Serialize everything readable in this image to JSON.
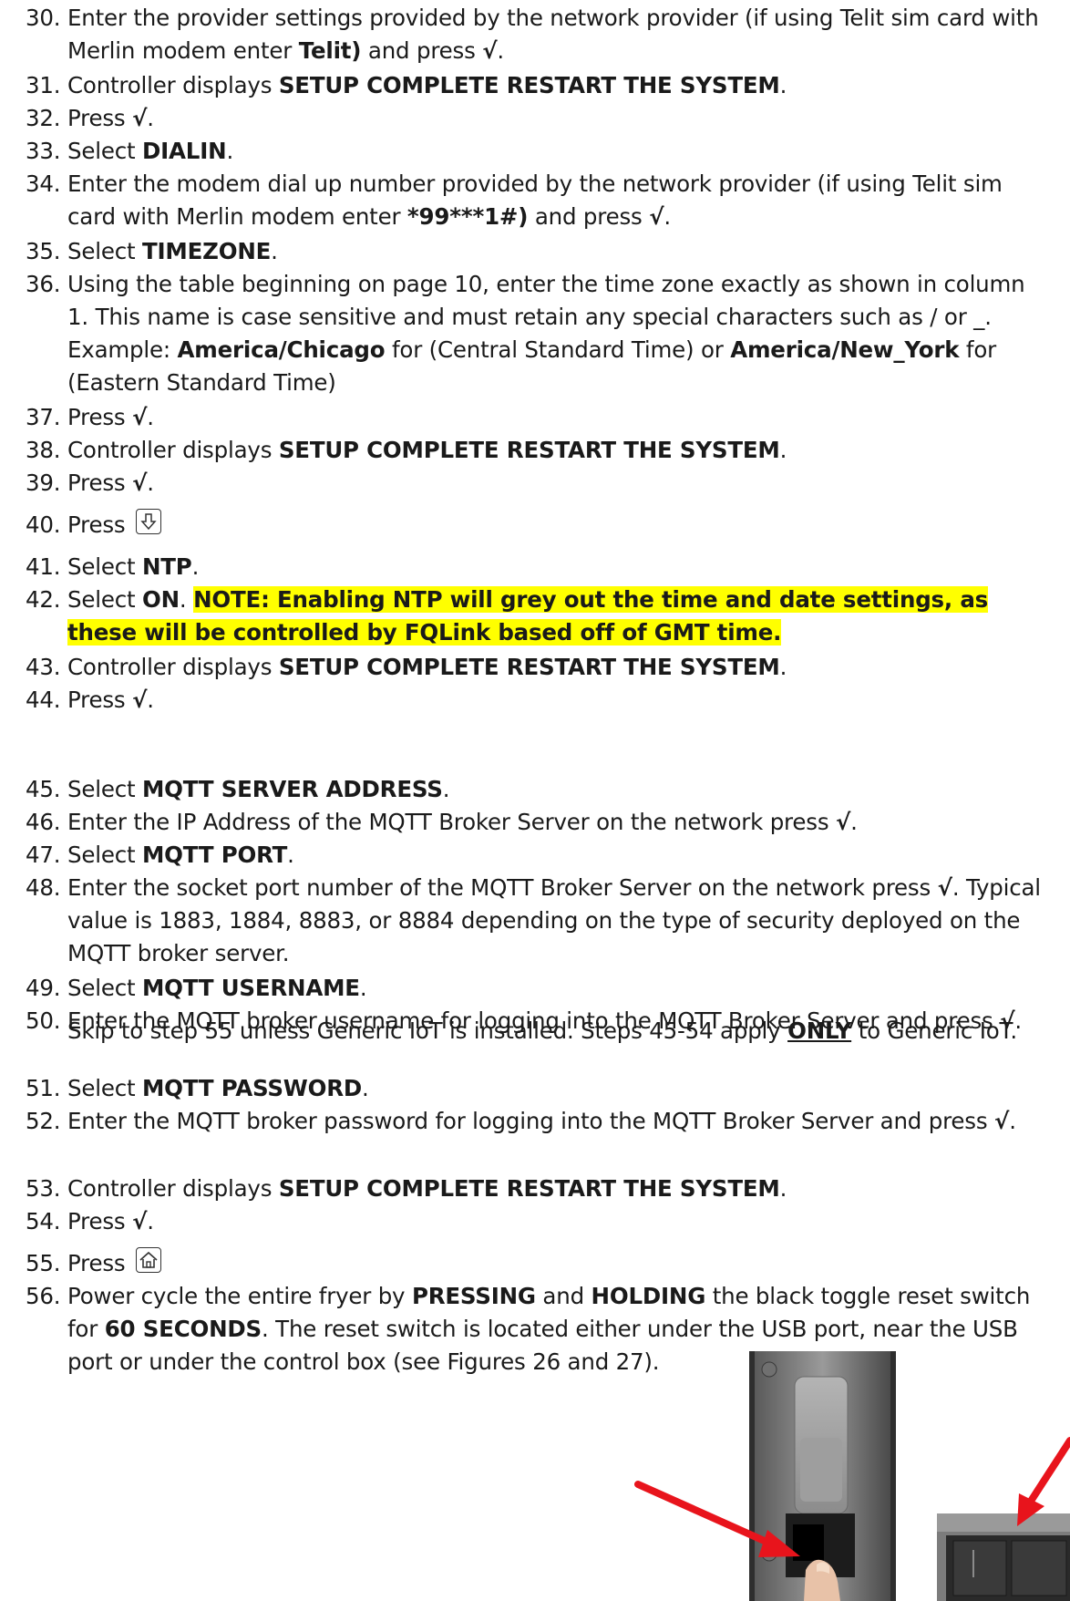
{
  "steps": [
    {
      "num": "30.",
      "parts": [
        [
          "Enter the provider settings provided by the network provider (if using Telit sim card with Merlin modem enter ",
          0
        ],
        [
          "Telit)",
          1
        ],
        [
          " and press ",
          0
        ],
        [
          "√",
          1
        ],
        [
          ".",
          0
        ]
      ]
    },
    {
      "num": "31.",
      "parts": [
        [
          "Controller displays ",
          0
        ],
        [
          "SETUP COMPLETE RESTART THE SYSTEM",
          1
        ],
        [
          ".",
          0
        ]
      ]
    },
    {
      "num": "32.",
      "parts": [
        [
          "Press ",
          0
        ],
        [
          "√",
          1
        ],
        [
          ".",
          0
        ]
      ]
    },
    {
      "num": "33.",
      "parts": [
        [
          "Select ",
          0
        ],
        [
          "DIALIN",
          1
        ],
        [
          ".",
          0
        ]
      ]
    },
    {
      "num": "34.",
      "parts": [
        [
          "Enter the modem dial up number provided by the network provider (if using Telit sim card with Merlin modem enter ",
          0
        ],
        [
          "*99***1#)",
          1
        ],
        [
          " and press ",
          0
        ],
        [
          "√",
          1
        ],
        [
          ".",
          0
        ]
      ]
    },
    {
      "num": "35.",
      "parts": [
        [
          "Select ",
          0
        ],
        [
          "TIMEZONE",
          1
        ],
        [
          ".",
          0
        ]
      ]
    },
    {
      "num": "36.",
      "parts": [
        [
          "Using the table beginning on page 10, enter the time zone exactly as shown in column 1.  This name is case sensitive and must retain any special characters such as / or _.  Example: ",
          0
        ],
        [
          "America/Chicago",
          1
        ],
        [
          " for (Central Standard Time) or ",
          0
        ],
        [
          "America/New_York",
          1
        ],
        [
          " for (Eastern Standard Time)",
          0
        ]
      ]
    },
    {
      "num": "37.",
      "parts": [
        [
          "Press ",
          0
        ],
        [
          "√",
          1
        ],
        [
          ".",
          0
        ]
      ]
    },
    {
      "num": "38.",
      "parts": [
        [
          "Controller displays ",
          0
        ],
        [
          "SETUP COMPLETE RESTART THE SYSTEM",
          1
        ],
        [
          ".",
          0
        ]
      ]
    },
    {
      "num": "39.",
      "parts": [
        [
          "Press ",
          0
        ],
        [
          "√",
          1
        ],
        [
          ".",
          0
        ]
      ]
    },
    {
      "num": "40.",
      "parts": [
        [
          "Press ",
          0
        ]
      ],
      "icon": "down-arrow-key-icon"
    },
    {
      "num": "41.",
      "parts": [
        [
          "Select ",
          0
        ],
        [
          "NTP",
          1
        ],
        [
          ".",
          0
        ]
      ]
    },
    {
      "num": "42.",
      "parts": [
        [
          "Select ",
          0
        ],
        [
          "ON",
          1
        ],
        [
          ".  ",
          0
        ],
        [
          "NOTE: Enabling NTP will grey out the time and date settings, as these will be controlled by FQLink based off of GMT time.",
          2
        ]
      ]
    },
    {
      "num": "43.",
      "parts": [
        [
          "Controller displays ",
          0
        ],
        [
          "SETUP COMPLETE RESTART THE SYSTEM",
          1
        ],
        [
          ".",
          0
        ]
      ]
    },
    {
      "num": "44.",
      "parts": [
        [
          "Press ",
          0
        ],
        [
          "√",
          1
        ],
        [
          ".",
          0
        ]
      ]
    },
    {
      "num": "45.",
      "parts": [
        [
          "Select ",
          0
        ],
        [
          "MQTT SERVER ADDRESS",
          1
        ],
        [
          ".",
          0
        ]
      ]
    },
    {
      "num": "46.",
      "parts": [
        [
          "Enter the IP Address of the MQTT Broker Server on the network press ",
          0
        ],
        [
          "√",
          1
        ],
        [
          ".",
          0
        ]
      ]
    },
    {
      "num": "47.",
      "parts": [
        [
          "Select ",
          0
        ],
        [
          "MQTT PORT",
          1
        ],
        [
          ".",
          0
        ]
      ]
    },
    {
      "num": "48.",
      "parts": [
        [
          "Enter the socket port number of the MQTT Broker Server on the network press ",
          0
        ],
        [
          "√",
          1
        ],
        [
          ". Typical value is 1883, 1884, 8883, or 8884 depending on the type of security deployed on the MQTT broker server.",
          0
        ]
      ]
    },
    {
      "num": "49.",
      "parts": [
        [
          "Select ",
          0
        ],
        [
          "MQTT USERNAME",
          1
        ],
        [
          ".",
          0
        ]
      ]
    },
    {
      "num": "50.",
      "parts": [
        [
          "Enter the MQTT broker username for logging into the MQTT Broker Server and press ",
          0
        ],
        [
          "√",
          1
        ],
        [
          ".",
          0
        ]
      ]
    },
    {
      "num": "51.",
      "parts": [
        [
          "Select ",
          0
        ],
        [
          "MQTT PASSWORD",
          1
        ],
        [
          ".",
          0
        ]
      ]
    },
    {
      "num": "52.",
      "parts": [
        [
          "Enter the MQTT broker password for logging into the MQTT Broker Server and press ",
          0
        ],
        [
          "√",
          1
        ],
        [
          ".",
          0
        ]
      ]
    },
    {
      "num": "53.",
      "parts": [
        [
          "Controller displays ",
          0
        ],
        [
          "SETUP COMPLETE RESTART THE SYSTEM",
          1
        ],
        [
          ".",
          0
        ]
      ]
    },
    {
      "num": "54.",
      "parts": [
        [
          "Press ",
          0
        ],
        [
          "√",
          1
        ],
        [
          ".",
          0
        ]
      ]
    },
    {
      "num": "55.",
      "parts": [
        [
          "Press ",
          0
        ]
      ],
      "icon": "home-key-icon"
    },
    {
      "num": "56.",
      "parts": [
        [
          "Power cycle the entire fryer by ",
          0
        ],
        [
          "PRESSING",
          1
        ],
        [
          " and ",
          0
        ],
        [
          "HOLDING",
          1
        ],
        [
          " the black toggle reset switch for ",
          0
        ],
        [
          "60 SECONDS",
          1
        ],
        [
          ". The reset switch is located either under the USB port, near the USB port or under the control box (see Figures 26 and 27).",
          0
        ]
      ]
    }
  ],
  "note_44": {
    "before": "Skip to step 55 unless Generic IoT is installed. Steps 45-54 apply ",
    "emph": "ONLY",
    "after": " to Generic IoT."
  },
  "colors": {
    "highlight": "#ffff00",
    "arrow": "#e8141c"
  }
}
